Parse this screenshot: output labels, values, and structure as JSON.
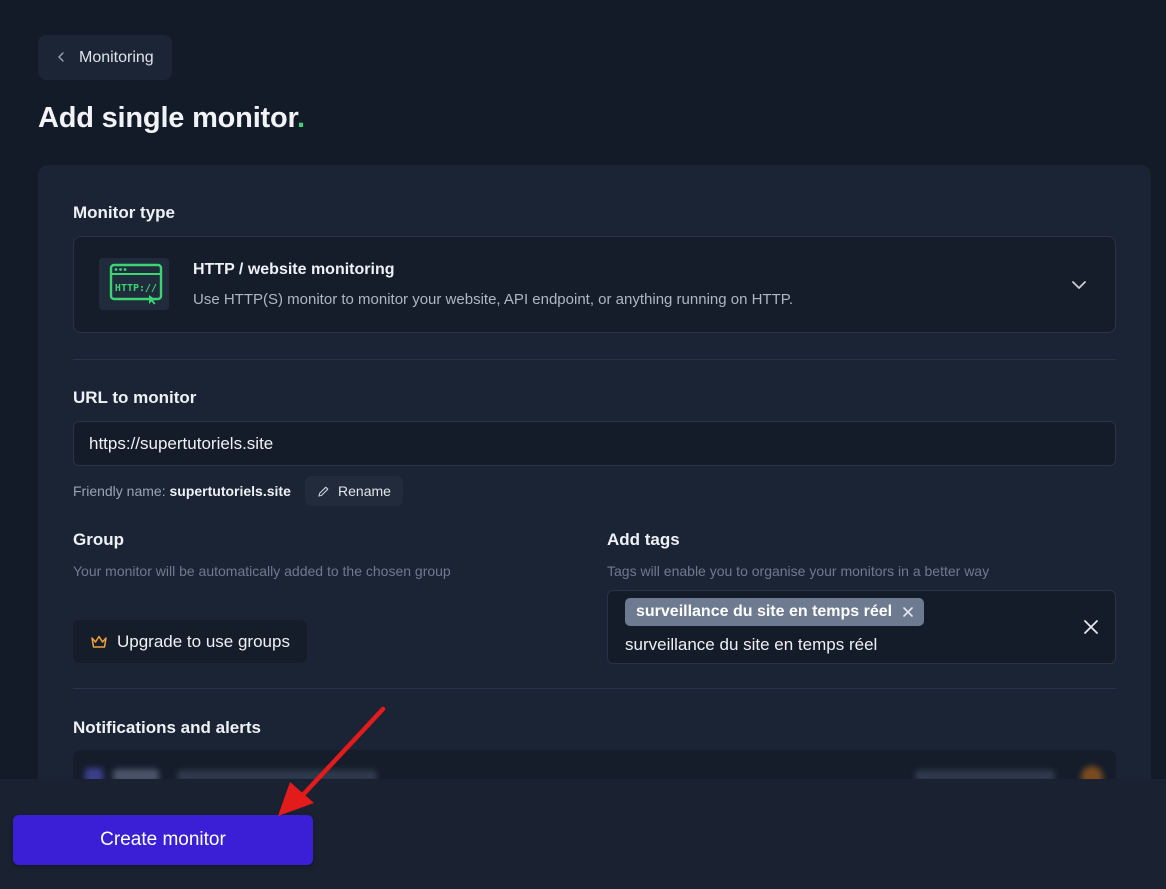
{
  "back_button": {
    "label": "Monitoring"
  },
  "page": {
    "title": "Add single monitor",
    "title_dot": "."
  },
  "monitor_type": {
    "label": "Monitor type",
    "icon_text": "HTTP://",
    "selected_title": "HTTP / website monitoring",
    "selected_description": "Use HTTP(S) monitor to monitor your website, API endpoint, or anything running on HTTP."
  },
  "url": {
    "label": "URL to monitor",
    "value": "https://supertutoriels.site",
    "friendly_prefix": "Friendly name: ",
    "friendly_value": "supertutoriels.site",
    "rename_label": "Rename"
  },
  "group": {
    "label": "Group",
    "helper": "Your monitor will be automatically added to the chosen group",
    "upgrade_label": "Upgrade to use groups"
  },
  "tags": {
    "label": "Add tags",
    "helper": "Tags will enable you to organise your monitors in a better way",
    "chips": [
      "surveillance du site en temps réel"
    ],
    "input_value": "surveillance du site en temps réel"
  },
  "notifications": {
    "label": "Notifications and alerts"
  },
  "footer": {
    "create_label": "Create monitor"
  },
  "colors": {
    "background": "#131a28",
    "card": "#1b2434",
    "accent_green": "#3bd671",
    "primary_button": "#3b1fd6",
    "annotation_arrow": "#e41b1b",
    "tag_chip": "#6d7a90",
    "crown_orange": "#f0a23a"
  }
}
